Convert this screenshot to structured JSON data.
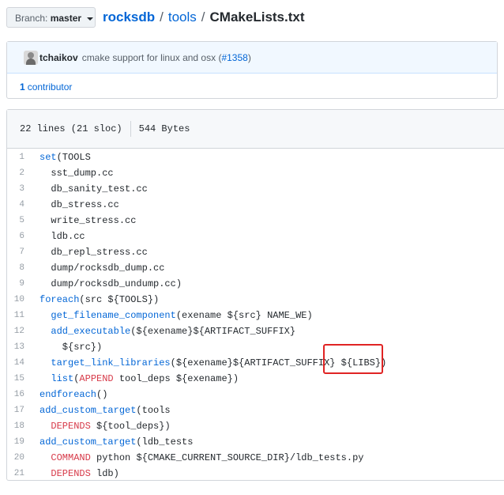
{
  "branch": {
    "label": "Branch:",
    "value": "master"
  },
  "breadcrumb": {
    "repo": "rocksdb",
    "sep1": "/",
    "dir": "tools",
    "sep2": "/",
    "file": "CMakeLists.txt"
  },
  "commit": {
    "author": "tchaikov",
    "message": "cmake support for linux and osx (",
    "link": "#1358",
    "close": ")"
  },
  "contributors": {
    "count": "1",
    "label": "contributor"
  },
  "file_info": {
    "lines": "22 lines (21 sloc)",
    "size": "544 Bytes"
  },
  "code_lines": [
    {
      "n": "1",
      "tokens": [
        {
          "t": "set",
          "c": "k"
        },
        {
          "t": "(TOOLS",
          "c": "p"
        }
      ]
    },
    {
      "n": "2",
      "tokens": [
        {
          "t": "  sst_dump.cc",
          "c": "p"
        }
      ]
    },
    {
      "n": "3",
      "tokens": [
        {
          "t": "  db_sanity_test.cc",
          "c": "p"
        }
      ]
    },
    {
      "n": "4",
      "tokens": [
        {
          "t": "  db_stress.cc",
          "c": "p"
        }
      ]
    },
    {
      "n": "5",
      "tokens": [
        {
          "t": "  write_stress.cc",
          "c": "p"
        }
      ]
    },
    {
      "n": "6",
      "tokens": [
        {
          "t": "  ldb.cc",
          "c": "p"
        }
      ]
    },
    {
      "n": "7",
      "tokens": [
        {
          "t": "  db_repl_stress.cc",
          "c": "p"
        }
      ]
    },
    {
      "n": "8",
      "tokens": [
        {
          "t": "  dump/rocksdb_dump.cc",
          "c": "p"
        }
      ]
    },
    {
      "n": "9",
      "tokens": [
        {
          "t": "  dump/rocksdb_undump.cc)",
          "c": "p"
        }
      ]
    },
    {
      "n": "10",
      "tokens": [
        {
          "t": "foreach",
          "c": "k"
        },
        {
          "t": "(src ${TOOLS})",
          "c": "p"
        }
      ]
    },
    {
      "n": "11",
      "tokens": [
        {
          "t": "  ",
          "c": "p"
        },
        {
          "t": "get_filename_component",
          "c": "k"
        },
        {
          "t": "(exename ${src} NAME_WE)",
          "c": "p"
        }
      ]
    },
    {
      "n": "12",
      "tokens": [
        {
          "t": "  ",
          "c": "p"
        },
        {
          "t": "add_executable",
          "c": "k"
        },
        {
          "t": "(${exename}${ARTIFACT_SUFFIX}",
          "c": "p"
        }
      ]
    },
    {
      "n": "13",
      "tokens": [
        {
          "t": "    ${src})",
          "c": "p"
        }
      ]
    },
    {
      "n": "14",
      "tokens": [
        {
          "t": "  ",
          "c": "p"
        },
        {
          "t": "target_link_libraries",
          "c": "k"
        },
        {
          "t": "(${exename}${ARTIFACT_SUFFIX} ${LIBS})",
          "c": "p"
        }
      ]
    },
    {
      "n": "15",
      "tokens": [
        {
          "t": "  ",
          "c": "p"
        },
        {
          "t": "list",
          "c": "k"
        },
        {
          "t": "(",
          "c": "p"
        },
        {
          "t": "APPEND",
          "c": "r"
        },
        {
          "t": " tool_deps ${exename})",
          "c": "p"
        }
      ]
    },
    {
      "n": "16",
      "tokens": [
        {
          "t": "endforeach",
          "c": "k"
        },
        {
          "t": "()",
          "c": "p"
        }
      ]
    },
    {
      "n": "17",
      "tokens": [
        {
          "t": "add_custom_target",
          "c": "k"
        },
        {
          "t": "(tools",
          "c": "p"
        }
      ]
    },
    {
      "n": "18",
      "tokens": [
        {
          "t": "  ",
          "c": "p"
        },
        {
          "t": "DEPENDS",
          "c": "r"
        },
        {
          "t": " ${tool_deps})",
          "c": "p"
        }
      ]
    },
    {
      "n": "19",
      "tokens": [
        {
          "t": "add_custom_target",
          "c": "k"
        },
        {
          "t": "(ldb_tests",
          "c": "p"
        }
      ]
    },
    {
      "n": "20",
      "tokens": [
        {
          "t": "  ",
          "c": "p"
        },
        {
          "t": "COMMAND",
          "c": "r"
        },
        {
          "t": " python ${CMAKE_CURRENT_SOURCE_DIR}/ldb_tests.py",
          "c": "p"
        }
      ]
    },
    {
      "n": "21",
      "tokens": [
        {
          "t": "  ",
          "c": "p"
        },
        {
          "t": "DEPENDS",
          "c": "r"
        },
        {
          "t": " ldb)",
          "c": "p"
        }
      ]
    }
  ],
  "colors": {
    "link": "#0366d6",
    "keyword": "#0366d6",
    "constant": "#d73a49",
    "highlight": "#e02424"
  },
  "icons": {
    "avatar": "user-avatar",
    "caret": "caret-down-icon"
  }
}
